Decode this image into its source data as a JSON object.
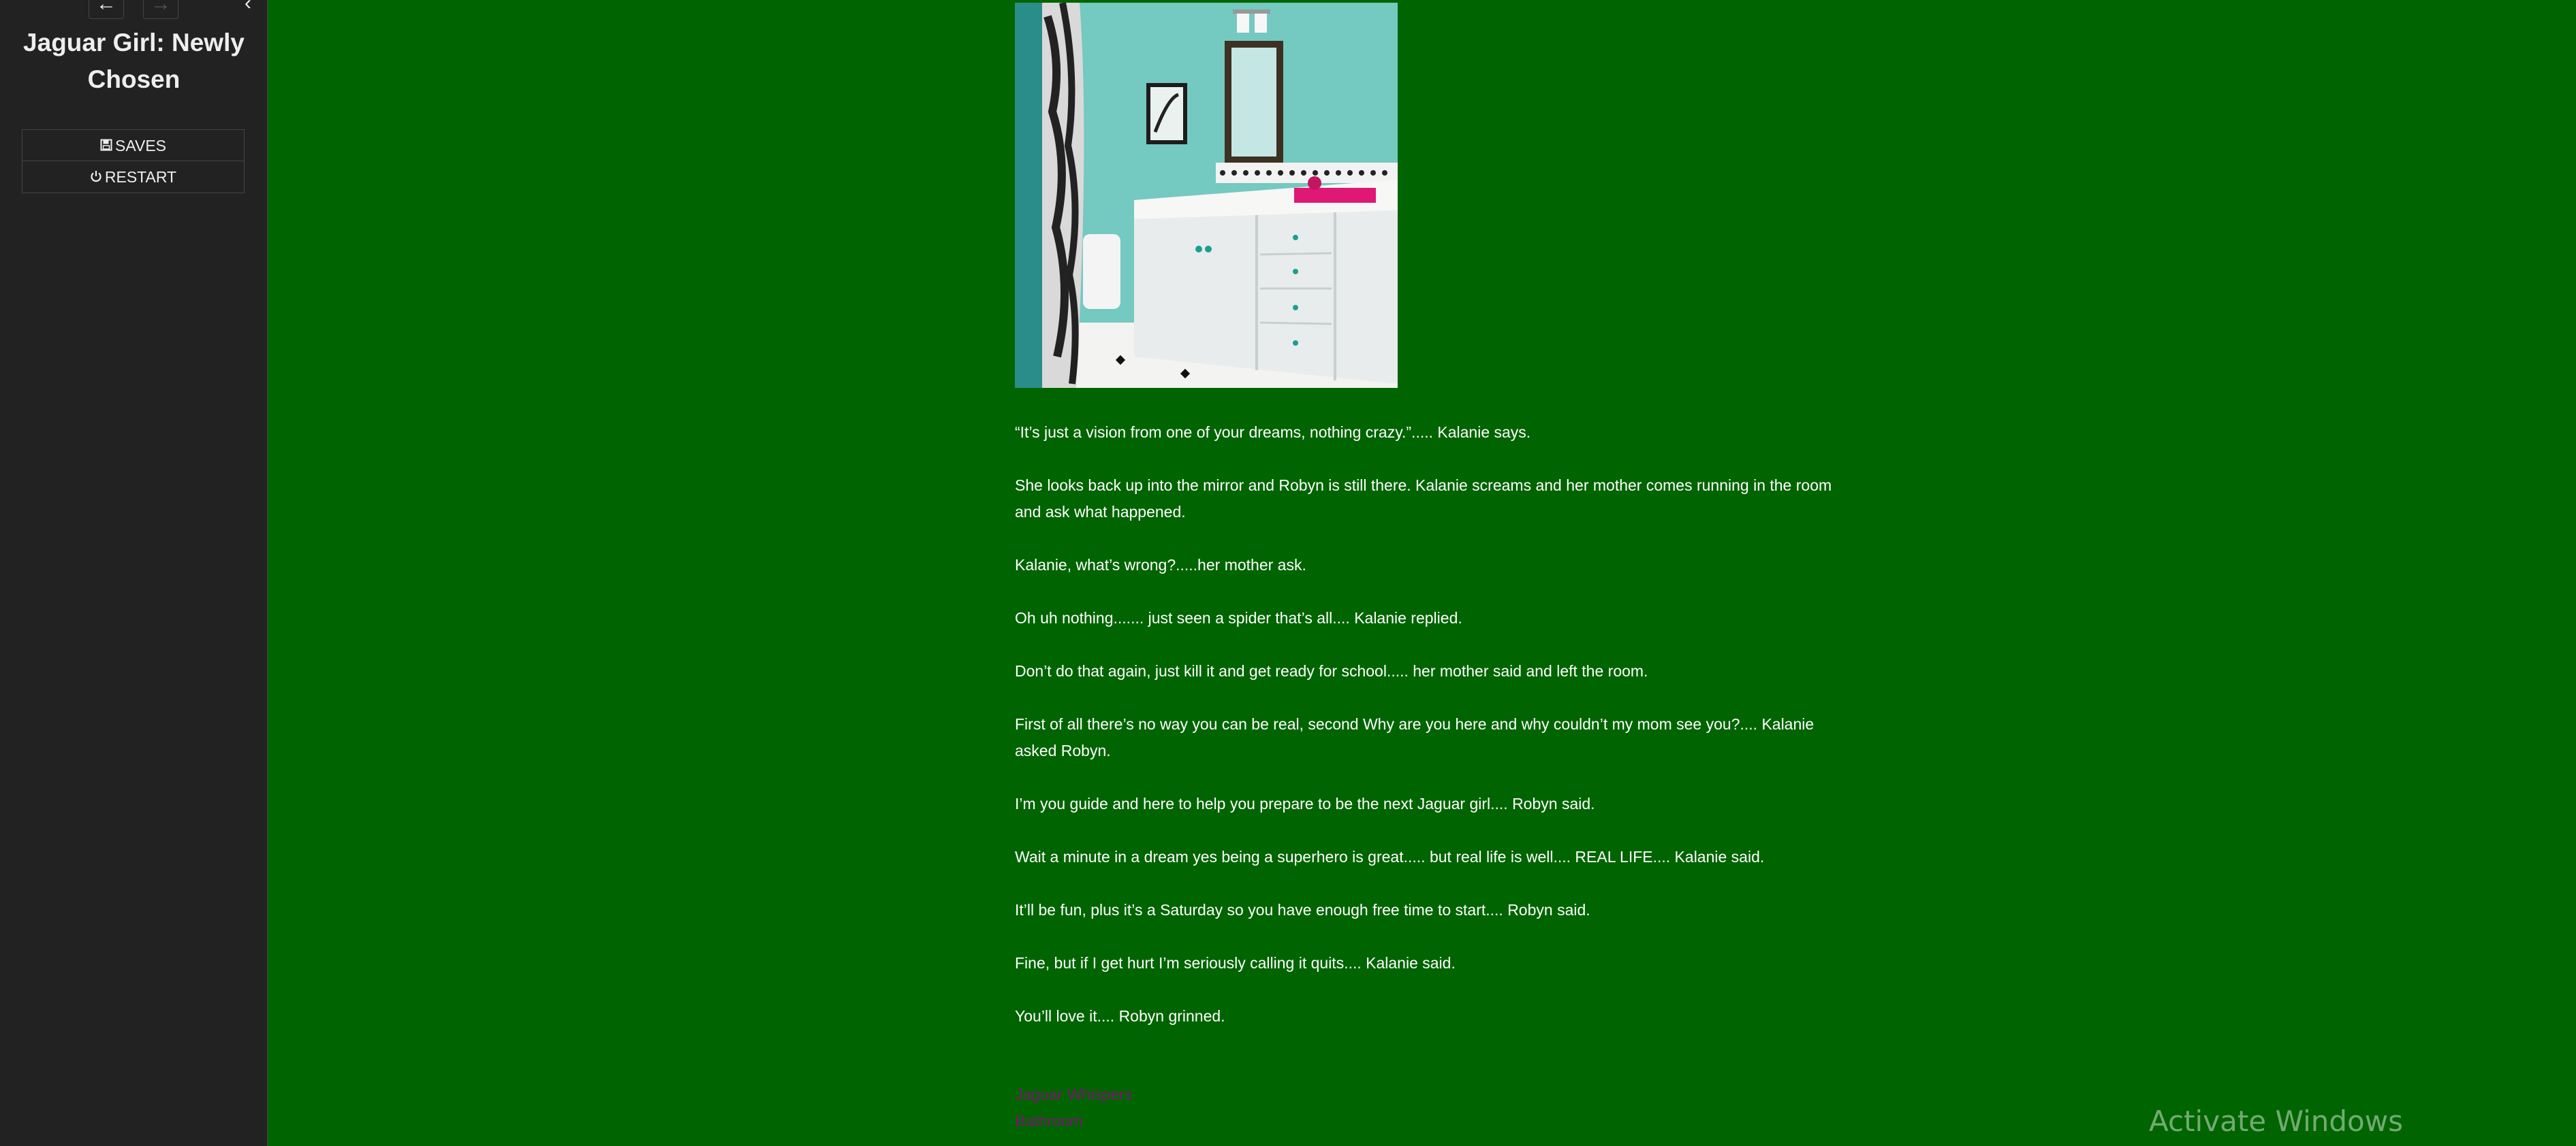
{
  "sidebar": {
    "back_icon": "arrow-left-icon",
    "forward_icon": "arrow-right-icon",
    "toggle_icon": "chevron-left-icon",
    "title": "Jaguar Girl: Newly Chosen",
    "menu": [
      {
        "label": "SAVES",
        "icon": "save-icon"
      },
      {
        "label": "RESTART",
        "icon": "power-icon"
      }
    ]
  },
  "passage": {
    "paragraphs": [
      "“It’s just a vision from one of your dreams, nothing crazy.”..... Kalanie says.",
      "She looks back up into the mirror and Robyn is still there. Kalanie screams and her mother comes running in the room and ask what happened.",
      "Kalanie, what’s wrong?.....her mother ask.",
      "Oh uh nothing....... just seen a spider that’s all.... Kalanie replied.",
      "Don’t do that again, just kill it and get ready for school..... her mother said and left the room.",
      "First of all there’s no way you can be real, second Why are you here and why couldn’t my mom see you?.... Kalanie asked Robyn.",
      "I’m you guide and here to help you prepare to be the next Jaguar girl.... Robyn said.",
      "Wait a minute in a dream yes being a superhero is great..... but real life is well.... REAL LIFE.... Kalanie said.",
      "It’ll be fun, plus it’s a Saturday so you have enough free time to start.... Robyn said.",
      "Fine, but if I get hurt I’m seriously calling it quits.... Kalanie said.",
      "You’ll love it.... Robyn grinned."
    ],
    "links": [
      "Jaguar Whispers",
      "Bathroom"
    ],
    "link_color": "#7a1570",
    "background_color": "#006400"
  },
  "system": {
    "watermark": "Activate Windows"
  }
}
